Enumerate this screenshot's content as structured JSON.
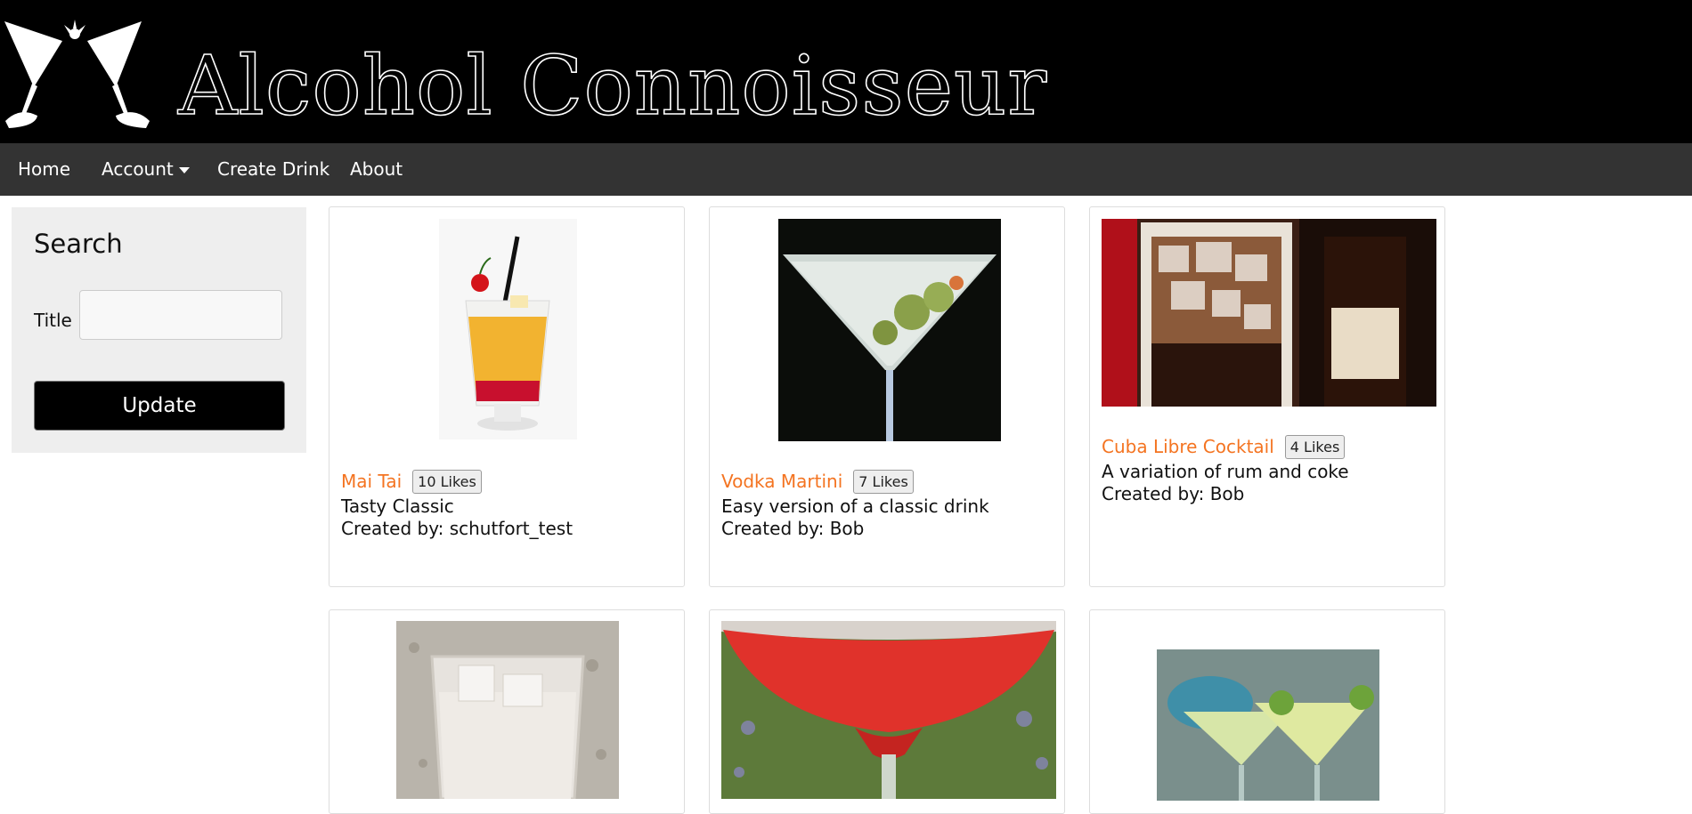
{
  "header": {
    "site_title": "Alcohol Connoisseur",
    "logo_icon": "clinking-glasses-icon"
  },
  "nav": {
    "home": "Home",
    "account": "Account",
    "create_drink": "Create Drink",
    "about": "About"
  },
  "search": {
    "heading": "Search",
    "title_label": "Title",
    "title_value": "",
    "update_label": "Update"
  },
  "drinks": [
    {
      "title": "Mai Tai",
      "likes": "10 Likes",
      "description": "Tasty Classic",
      "created_by_prefix": "Created by: ",
      "creator": "schutfort_test"
    },
    {
      "title": "Vodka Martini",
      "likes": "7 Likes",
      "description": "Easy version of a classic drink",
      "created_by_prefix": "Created by: ",
      "creator": "Bob"
    },
    {
      "title": "Cuba Libre Cocktail",
      "likes": "4 Likes",
      "description": "A variation of rum and coke",
      "created_by_prefix": "Created by: ",
      "creator": "Bob"
    },
    {
      "image": "white-russian-photo"
    },
    {
      "image": "strawberry-margarita-photo"
    },
    {
      "image": "lime-margaritas-photo"
    }
  ],
  "colors": {
    "accent": "#f47421",
    "header_bg": "#000000",
    "nav_bg": "#333333",
    "panel_bg": "#eeeeee"
  }
}
